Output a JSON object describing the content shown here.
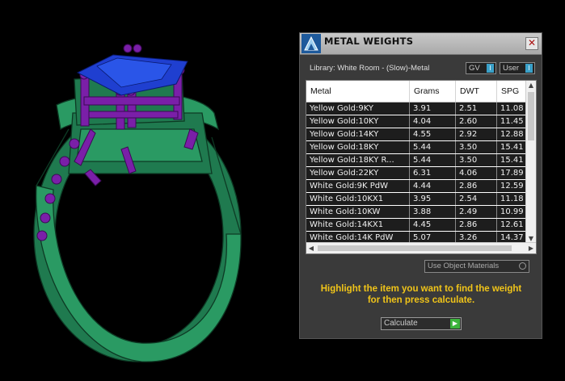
{
  "panel": {
    "title": "METAL WEIGHTS",
    "close_glyph": "✕",
    "library": "Library: White Room - (Slow)-Metal",
    "gv_label": "GV",
    "user_label": "User",
    "toggle_glyph": "I",
    "columns": [
      "Metal",
      "Grams",
      "DWT",
      "SPG"
    ],
    "rows": [
      [
        "Yellow Gold:9KY",
        "3.91",
        "2.51",
        "11.08"
      ],
      [
        "Yellow Gold:10KY",
        "4.04",
        "2.60",
        "11.45"
      ],
      [
        "Yellow Gold:14KY",
        "4.55",
        "2.92",
        "12.88"
      ],
      [
        "Yellow Gold:18KY",
        "5.44",
        "3.50",
        "15.41"
      ],
      [
        "Yellow Gold:18KY R...",
        "5.44",
        "3.50",
        "15.41"
      ],
      [
        "Yellow Gold:22KY",
        "6.31",
        "4.06",
        "17.89"
      ],
      [
        "White Gold:9K PdW",
        "4.44",
        "2.86",
        "12.59"
      ],
      [
        "White Gold:10KX1",
        "3.95",
        "2.54",
        "11.18"
      ],
      [
        "White Gold:10KW",
        "3.88",
        "2.49",
        "10.99"
      ],
      [
        "White Gold:14KX1",
        "4.45",
        "2.86",
        "12.61"
      ],
      [
        "White Gold:14K PdW",
        "5.07",
        "3.26",
        "14.37"
      ]
    ],
    "scroll_up": "▲",
    "scroll_down": "▼",
    "scroll_left": "◀",
    "scroll_right": "▶",
    "use_object_materials": "Use Object Materials",
    "instructions_line1": "Highlight the item you want to find the weight",
    "instructions_line2": "for then press calculate.",
    "calculate_label": "Calculate",
    "calculate_glyph": "▶"
  },
  "colors": {
    "ring_metal": "#1f7a4f",
    "prongs": "#7a1fa8",
    "stone": "#1f3fd0",
    "instruction_text": "#f0c419"
  },
  "icons": {
    "logo": "rhino-logo-icon",
    "close": "close-icon",
    "calculate": "play-arrow-icon"
  }
}
